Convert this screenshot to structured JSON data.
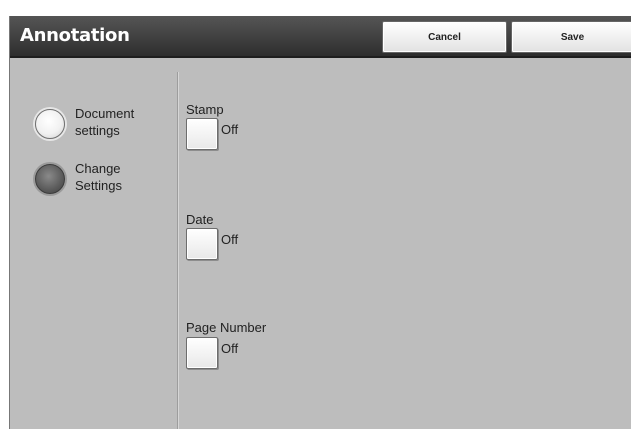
{
  "header": {
    "title": "Annotation",
    "cancel_label": "Cancel",
    "save_label": "Save"
  },
  "radio_options": [
    {
      "label_line1": "Document",
      "label_line2": "settings",
      "selected": false
    },
    {
      "label_line1": "Change",
      "label_line2": "Settings",
      "selected": true
    }
  ],
  "annotations": [
    {
      "label": "Stamp",
      "state": "Off"
    },
    {
      "label": "Date",
      "state": "Off"
    },
    {
      "label": "Page Number",
      "state": "Off"
    }
  ]
}
